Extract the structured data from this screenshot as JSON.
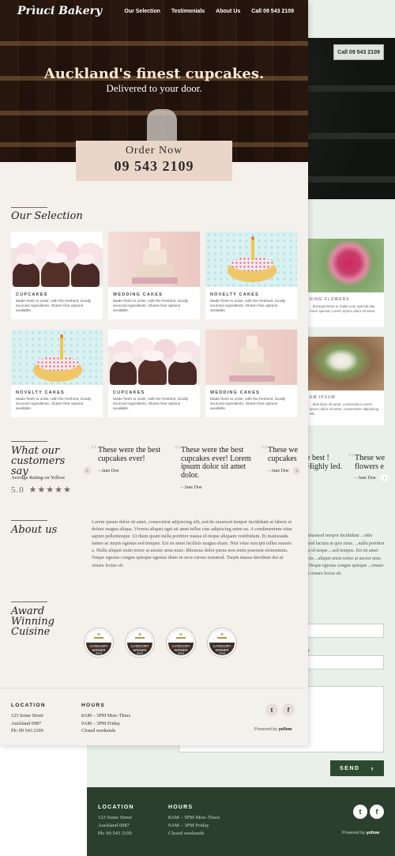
{
  "bakery": {
    "logo": "Prìuci Bakery",
    "nav": [
      "Our Selection",
      "Testimonials",
      "About Us",
      "Call 09 543 2109"
    ],
    "hero_title": "Auckland's finest cupcakes.",
    "hero_subtitle": "Delivered to your door.",
    "order_label": "Order Now",
    "order_phone": "09 543 2109",
    "selection_title": "Our Selection",
    "cards": [
      {
        "caption": "CUPCAKES",
        "text": "Made fresh to order, with the freshest, locally sourced ingredients. Gluten-free options available."
      },
      {
        "caption": "WEDDING CAKES",
        "text": "Made fresh to order, with the freshest, locally sourced ingredients. Gluten-free options available."
      },
      {
        "caption": "NOVELTY CAKES",
        "text": "Made fresh to order, with the freshest, locally sourced ingredients. Gluten-free options available."
      },
      {
        "caption": "NOVELTY CAKES",
        "text": "Made fresh to order, with the freshest, locally sourced ingredients. Gluten-free options available."
      },
      {
        "caption": "CUPCAKES",
        "text": "Made fresh to order, with the freshest, locally sourced ingredients. Gluten-free options available."
      },
      {
        "caption": "WEDDING CAKES",
        "text": "Made fresh to order, with the freshest, locally sourced ingredients. Gluten-free options available."
      }
    ],
    "testimonials_title": "What our customers say",
    "rating_label": "Average Rating on Yellow",
    "rating_value": "5.0",
    "rating_stars": "★★★★★",
    "quotes": [
      {
        "text": "These were the best cupcakes ever!",
        "author": "– Jane Doe"
      },
      {
        "text": "These were the best cupcakes ever! Lorem ipsum dolor sit amet dolor.",
        "author": "– Jane Doe"
      },
      {
        "text": "These we cupcakes",
        "author": "– Jane Doe"
      }
    ],
    "about_title": "About us",
    "about_text": "Lorem ipsum dolor sit amet, consectetur adipiscing elit, sed do eiusmod tempor incididunt ut labore et dolore magna aliqua. Viverra aliquet eget sit amet tellus cras adipiscing enim eu. A condimentum vitae sapien pellentesque. Ut diam quam nulla porttitor massa id neque aliquam vestibulum. Et malesuada fames ac turpis egestas sed tempus. Est sit amet facilisis magna etiam. Nisi vitae suscipit tellus mauris a. Nulla aliquet enim tortor at auctor urna nunc. Rhoncus dolor purus non enim praesent elementum. Neque egestas congue quisque egestas diam in arcu cursus euismod. Turpis massa tincidunt dui ut ornare lectus sit.",
    "award_title": "Award Winning Cuisine",
    "badges": [
      {
        "line1": "CATEGORY",
        "line2": "WINNER",
        "year": "2016"
      },
      {
        "line1": "CATEGORY",
        "line2": "WINNER",
        "year": "2016"
      },
      {
        "line1": "CATEGORY",
        "line2": "WINNER",
        "year": "2016"
      },
      {
        "line1": "CATEGORY",
        "line2": "WINNER",
        "year": "2016"
      }
    ],
    "footer": {
      "location_title": "LOCATION",
      "location_lines": [
        "123 Some Street",
        "Auckland 0987",
        "Ph: 09 543 2109"
      ],
      "hours_title": "HOURS",
      "hours_lines": [
        "8AM – 5PM Mon–Thurs",
        "9AM – 3PM Friday",
        "Closed weekends"
      ],
      "powered_by": "Powered by",
      "powered_brand": "yellow"
    }
  },
  "florist": {
    "call_button": "Call 09 543 2109",
    "card_captions": [
      "DING FLOWERS",
      "EM IPSUM"
    ],
    "card_texts": [
      "...arrangements to make your special day more special. Lorem ipsum dolor sit amet.",
      "...ded dolor sit amet, consectetur Lorem ipsum dolor sit amet, consectetur adipiscing elit."
    ],
    "quotes": [
      {
        "text": "e best ! Highly led.",
        "author": ""
      },
      {
        "text": "These we flowers e",
        "author": "– Jane Doe"
      }
    ],
    "about_text": "...do eiusmod tempor incididunt ...odio euismod lacinia at quis risus. ...nulla porttitor massa id neque ...sed tempus. Est sit amet facilisis ...aliquet enim tortor at auctor urna ...rit. Neque egestas congue quisque ...ornare dui ut ornare lectus sit.",
    "form_labels": [
      "e",
      "mber"
    ],
    "send_label": "SEND",
    "footer": {
      "location_title": "LOCATION",
      "location_lines": [
        "123 Some Street",
        "Auckland 0987",
        "Ph: 09 543 2109"
      ],
      "hours_title": "HOURS",
      "hours_lines": [
        "8AM – 5PM Mon–Thurs",
        "9AM – 3PM Friday",
        "Closed weekends"
      ],
      "powered_by": "Powered by",
      "powered_brand": "yellow"
    }
  },
  "colors": {
    "bakery_bg": "#f4f0ec",
    "order_box": "#ead6c8",
    "florist_bg": "#e9efe9",
    "florist_footer": "#2a3f2c",
    "send_button": "#2c4a2f"
  }
}
